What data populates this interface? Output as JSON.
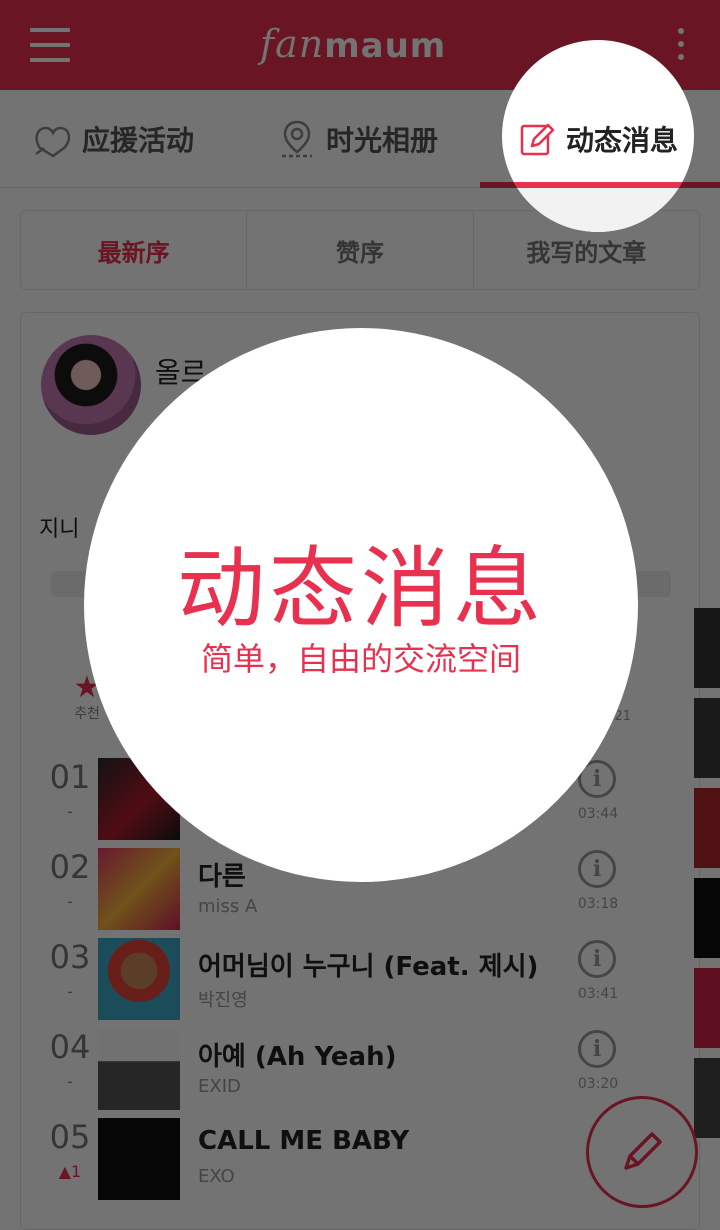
{
  "appbar": {
    "logo_light": "fan",
    "logo_bold": "maum",
    "bg_color": "#e8304f"
  },
  "tabs": [
    {
      "label": "应援活动",
      "icon": "heart-hands-icon"
    },
    {
      "label": "时光相册",
      "icon": "map-pin-icon"
    },
    {
      "label": "动态消息",
      "icon": "edit-note-icon",
      "active": true
    }
  ],
  "sort": [
    {
      "label": "最新序",
      "active": true
    },
    {
      "label": "赞序"
    },
    {
      "label": "我写的文章"
    }
  ],
  "card": {
    "username": "올르",
    "section_title": "지니",
    "star_label": "추천",
    "top_duration": "21"
  },
  "chart_rows": [
    {
      "rank": "01",
      "change": "-",
      "title": "",
      "artist": "",
      "duration": "03:44"
    },
    {
      "rank": "02",
      "change": "-",
      "title": "다른 ",
      "artist": "miss A",
      "duration": "03:18"
    },
    {
      "rank": "03",
      "change": "-",
      "title": "어머님이 누구니 (Feat. 제시)",
      "artist": "박진영",
      "duration": "03:41"
    },
    {
      "rank": "04",
      "change": "-",
      "title": "아예 (Ah Yeah)",
      "artist": "EXID",
      "duration": "03:20"
    },
    {
      "rank": "05",
      "change": "▲1",
      "title": "CALL ME BABY",
      "artist": "EXO",
      "duration": ""
    }
  ],
  "spotlight": {
    "title": "动态消息",
    "subtitle": "简单，自由的交流空间",
    "accent": "#e8304f"
  }
}
